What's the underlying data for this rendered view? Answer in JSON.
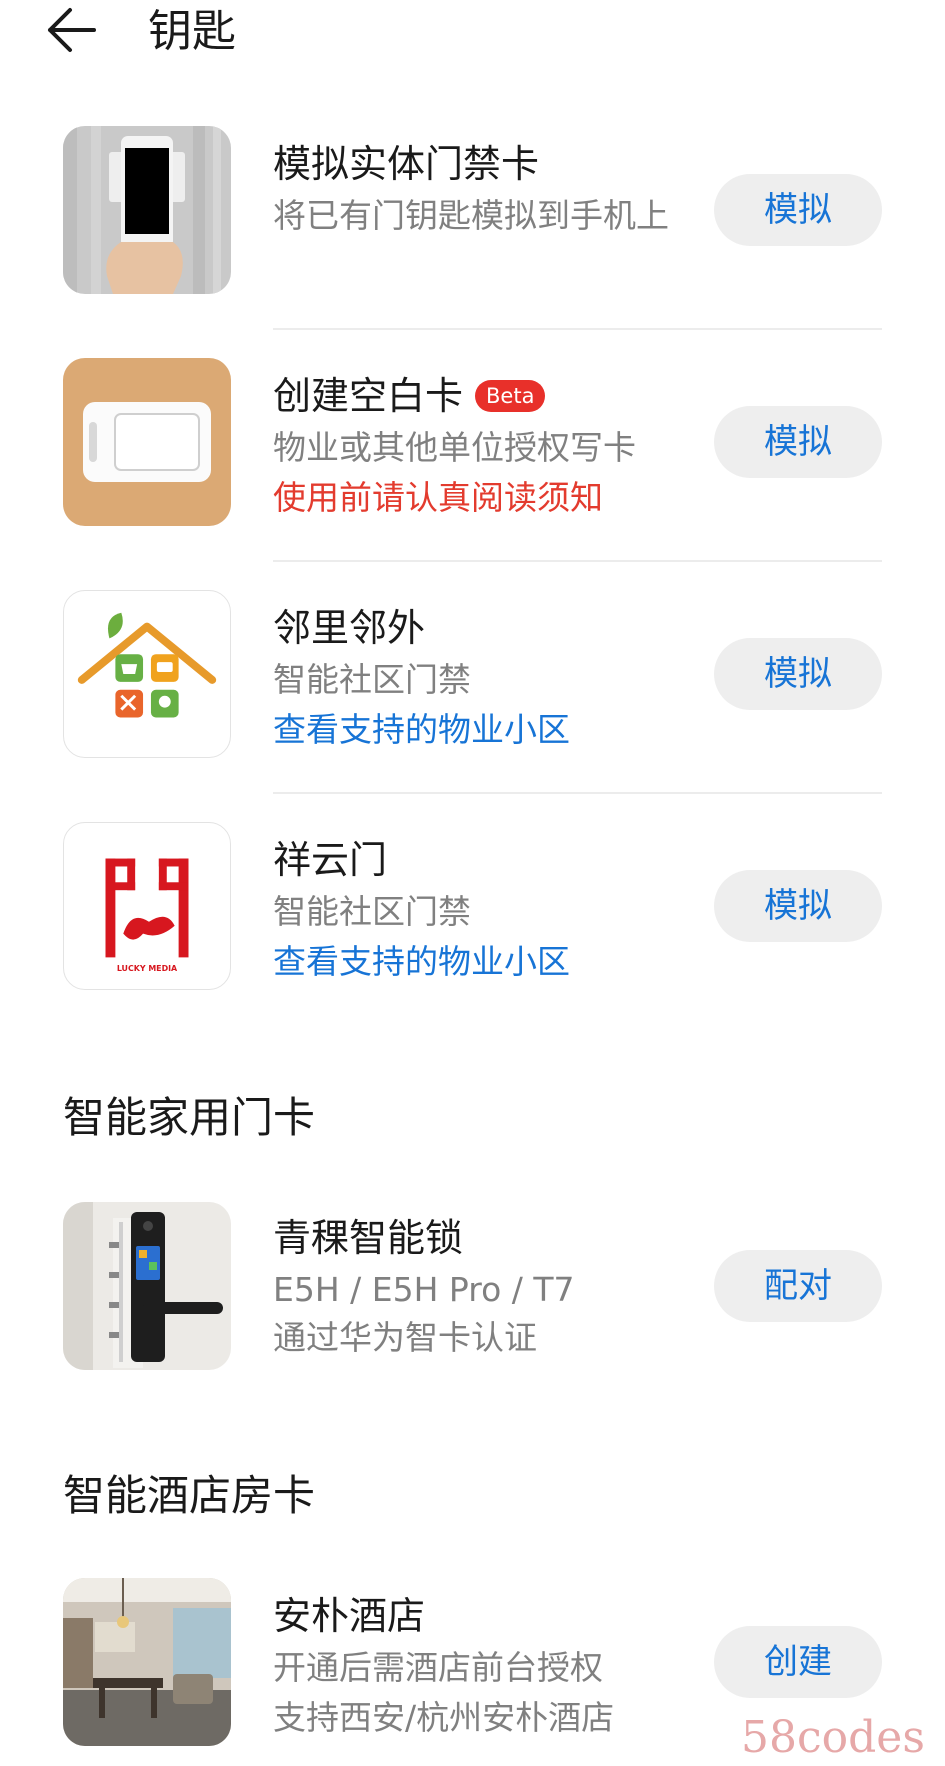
{
  "header": {
    "title": "钥匙",
    "back_icon": "arrow-left-icon"
  },
  "items": [
    {
      "title": "模拟实体门禁卡",
      "subtitle": "将已有门钥匙模拟到手机上",
      "button": "模拟"
    },
    {
      "title": "创建空白卡",
      "badge": "Beta",
      "subtitle": "物业或其他单位授权写卡",
      "notice": "使用前请认真阅读须知",
      "button": "模拟"
    },
    {
      "title": "邻里邻外",
      "subtitle": "智能社区门禁",
      "link": "查看支持的物业小区",
      "button": "模拟"
    },
    {
      "title": "祥云门",
      "subtitle": "智能社区门禁",
      "link": "查看支持的物业小区",
      "logo_text": "LUCKY MEDIA",
      "button": "模拟"
    }
  ],
  "sections": {
    "home": {
      "title": "智能家用门卡",
      "item": {
        "title": "青稞智能锁",
        "subtitle": "E5H / E5H Pro / T7",
        "detail": "通过华为智卡认证",
        "button": "配对"
      }
    },
    "hotel": {
      "title": "智能酒店房卡",
      "item": {
        "title": "安朴酒店",
        "subtitle": "开通后需酒店前台授权",
        "detail": "支持西安/杭州安朴酒店",
        "button": "创建"
      }
    }
  },
  "watermark": "58codes",
  "colors": {
    "link": "#1774d6",
    "notice": "#e33b2e",
    "badge": "#e8302a",
    "button_bg": "#eeeeee"
  }
}
